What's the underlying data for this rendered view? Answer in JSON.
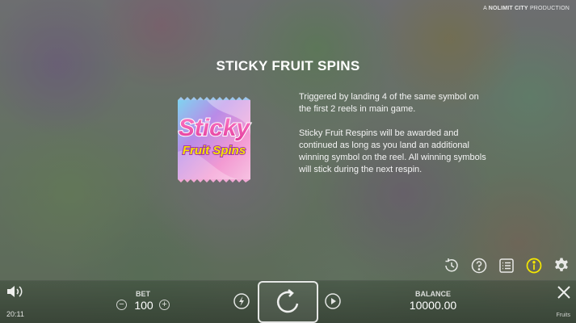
{
  "header": {
    "production_prefix": "A",
    "production_brand": "NOLIMIT CITY",
    "production_suffix": "PRODUCTION"
  },
  "info_page": {
    "title": "STICKY FRUIT SPINS",
    "logo": {
      "word1": "Sticky",
      "word2": "Fruit Spins"
    },
    "paragraph1": "Triggered by landing 4 of the same symbol on the first 2 reels in main game.",
    "paragraph2": "Sticky Fruit Respins will be awarded and continued as long as you land an additional winning symbol on the reel. All winning symbols will stick during the next respin."
  },
  "toolbar_icons": [
    {
      "name": "history-icon"
    },
    {
      "name": "help-icon"
    },
    {
      "name": "paytable-icon"
    },
    {
      "name": "info-icon",
      "active": true
    },
    {
      "name": "settings-icon"
    }
  ],
  "bottom_bar": {
    "time": "20:11",
    "bet_label": "BET",
    "bet_value": "100",
    "bet_minus": "−",
    "bet_plus": "+",
    "balance_label": "BALANCE",
    "balance_value": "10000.00",
    "game_name": "Fruits"
  },
  "colors": {
    "active_icon": "#f5e800",
    "text": "#ffffff"
  }
}
